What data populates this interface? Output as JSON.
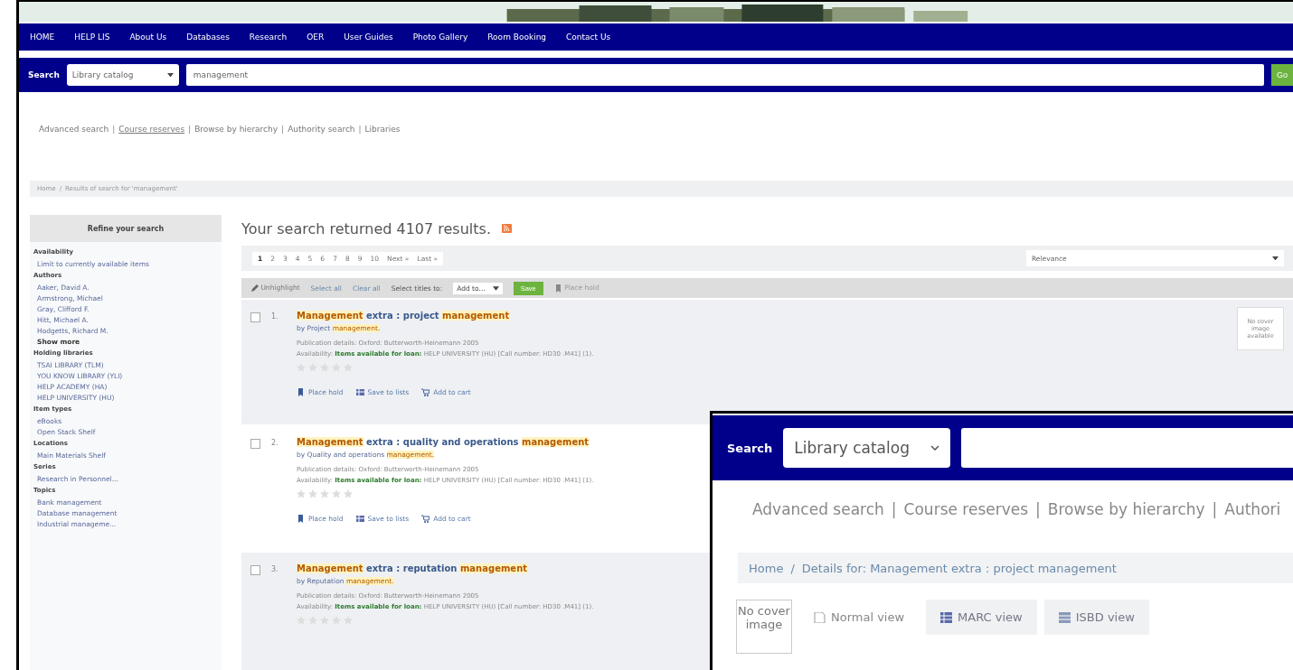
{
  "banner": {
    "kind": "picture"
  },
  "nav": {
    "items": [
      {
        "label": "HOME"
      },
      {
        "label": "HELP LIS"
      },
      {
        "label": "About Us"
      },
      {
        "label": "Databases"
      },
      {
        "label": "Research"
      },
      {
        "label": "OER"
      },
      {
        "label": "User Guides"
      },
      {
        "label": "Photo Gallery"
      },
      {
        "label": "Room Booking"
      },
      {
        "label": "Contact Us"
      }
    ]
  },
  "search": {
    "label": "Search",
    "scope": "Library catalog",
    "value": "management",
    "button": "Go"
  },
  "links": [
    {
      "label": "Advanced search",
      "underlined": false
    },
    {
      "label": "Course reserves",
      "underlined": true
    },
    {
      "label": "Browse by hierarchy",
      "underlined": false
    },
    {
      "label": "Authority search",
      "underlined": false
    },
    {
      "label": "Libraries",
      "underlined": false
    }
  ],
  "links_separator": "|",
  "breadcrumb": [
    "Home",
    "Results of search for 'management'"
  ],
  "breadcrumb_separator": "/",
  "sidebar": {
    "title": "Refine your search",
    "groups": [
      {
        "heading": "Availability",
        "items": [
          {
            "label": "Limit to currently available items"
          }
        ]
      },
      {
        "heading": "Authors",
        "items": [
          {
            "label": "Aaker, David A."
          },
          {
            "label": "Armstrong, Michael"
          },
          {
            "label": "Gray, Clifford F."
          },
          {
            "label": "Hitt, Michael A."
          },
          {
            "label": "Hodgetts, Richard M."
          },
          {
            "label": "Show more",
            "kind": "more"
          }
        ]
      },
      {
        "heading": "Holding libraries",
        "items": [
          {
            "label": "TSAI LIBRARY (TLM)"
          },
          {
            "label": "YOU KNOW LIBRARY (YLI)"
          },
          {
            "label": "HELP ACADEMY (HA)"
          },
          {
            "label": "HELP UNIVERSITY (HU)"
          }
        ]
      },
      {
        "heading": "Item types",
        "items": [
          {
            "label": "eBooks"
          },
          {
            "label": "Open Stack Shelf"
          }
        ]
      },
      {
        "heading": "Locations",
        "items": [
          {
            "label": "Main Materials Shelf"
          }
        ]
      },
      {
        "heading": "Series",
        "items": [
          {
            "label": "Research in Personnel..."
          }
        ]
      },
      {
        "heading": "Topics",
        "items": [
          {
            "label": "Bank management"
          },
          {
            "label": "Database management"
          },
          {
            "label": "Industrial manageme..."
          }
        ]
      }
    ]
  },
  "results_heading": "Your search returned 4107 results.",
  "pagination": [
    {
      "label": "1",
      "selected": true
    },
    {
      "label": "2",
      "selected": false
    },
    {
      "label": "3",
      "selected": false
    },
    {
      "label": "4",
      "selected": false
    },
    {
      "label": "5",
      "selected": false
    },
    {
      "label": "6",
      "selected": false
    },
    {
      "label": "7",
      "selected": false
    },
    {
      "label": "8",
      "selected": false
    },
    {
      "label": "9",
      "selected": false
    },
    {
      "label": "10",
      "selected": false
    },
    {
      "label": "Next »",
      "selected": false
    },
    {
      "label": "Last »",
      "selected": false
    }
  ],
  "sort": "Relevance",
  "toolbar": {
    "unhighlight": "Unhighlight",
    "select_all": "Select all",
    "clear_all": "Clear all",
    "select_titles": "Select titles to:",
    "add_to": "Add to...",
    "save": "Save",
    "place_hold": "Place hold"
  },
  "results": [
    {
      "number": "1.",
      "checked": false,
      "title": [
        {
          "text": "Management",
          "highlight": true
        },
        {
          "text": " extra : project ",
          "highlight": false
        },
        {
          "text": "management",
          "highlight": true
        }
      ],
      "by": [
        {
          "text": "by Project ",
          "highlight": false
        },
        {
          "text": "management.",
          "highlight": true
        }
      ],
      "publication": "Publication details: Oxford: Butterworth-Heinemann 2005",
      "availability_label": "Availability:",
      "availability_status": "Items available for loan:",
      "availability_detail": "HELP UNIVERSITY (HU) [Call number: HD30 .M41] (1).",
      "stars": 0,
      "actions": [
        "Place hold",
        "Save to lists",
        "Add to cart"
      ],
      "cover": "No cover image available"
    },
    {
      "number": "2.",
      "checked": false,
      "title": [
        {
          "text": "Management",
          "highlight": true
        },
        {
          "text": " extra : quality and operations ",
          "highlight": false
        },
        {
          "text": "management",
          "highlight": true
        }
      ],
      "by": [
        {
          "text": "by Quality and operations ",
          "highlight": false
        },
        {
          "text": "management.",
          "highlight": true
        }
      ],
      "publication": "Publication details: Oxford: Butterworth-Heinemann 2005",
      "availability_label": "Availability:",
      "availability_status": "Items available for loan:",
      "availability_detail": "HELP UNIVERSITY (HU) [Call number: HD30 .M41] (1).",
      "stars": 0,
      "actions": [
        "Place hold",
        "Save to lists",
        "Add to cart"
      ]
    },
    {
      "number": "3.",
      "checked": false,
      "title": [
        {
          "text": "Management",
          "highlight": true
        },
        {
          "text": " extra : reputation ",
          "highlight": false
        },
        {
          "text": "management",
          "highlight": true
        }
      ],
      "by": [
        {
          "text": "by Reputation ",
          "highlight": false
        },
        {
          "text": "management.",
          "highlight": true
        }
      ],
      "publication": "Publication details: Oxford: Butterworth-Heinemann 2005",
      "availability_label": "Availability:",
      "availability_status": "Items available for loan:",
      "availability_detail": "HELP UNIVERSITY (HU) [Call number: HD30 .M41] (1).",
      "stars": 0
    }
  ],
  "inset": {
    "search_label": "Search",
    "scope": "Library catalog",
    "links": [
      "Advanced search",
      "Course reserves",
      "Browse by hierarchy",
      "Authori"
    ],
    "links_separator": "|",
    "breadcrumb_separator": "/",
    "breadcrumb": [
      "Home",
      "Details for: Management extra : project management"
    ],
    "cover": "No cover image",
    "tabs": [
      {
        "label": "Normal view",
        "kind": "normal",
        "selected": true
      },
      {
        "label": "MARC view",
        "kind": "marc",
        "selected": false
      },
      {
        "label": "ISBD view",
        "kind": "isbd",
        "selected": false
      }
    ]
  }
}
